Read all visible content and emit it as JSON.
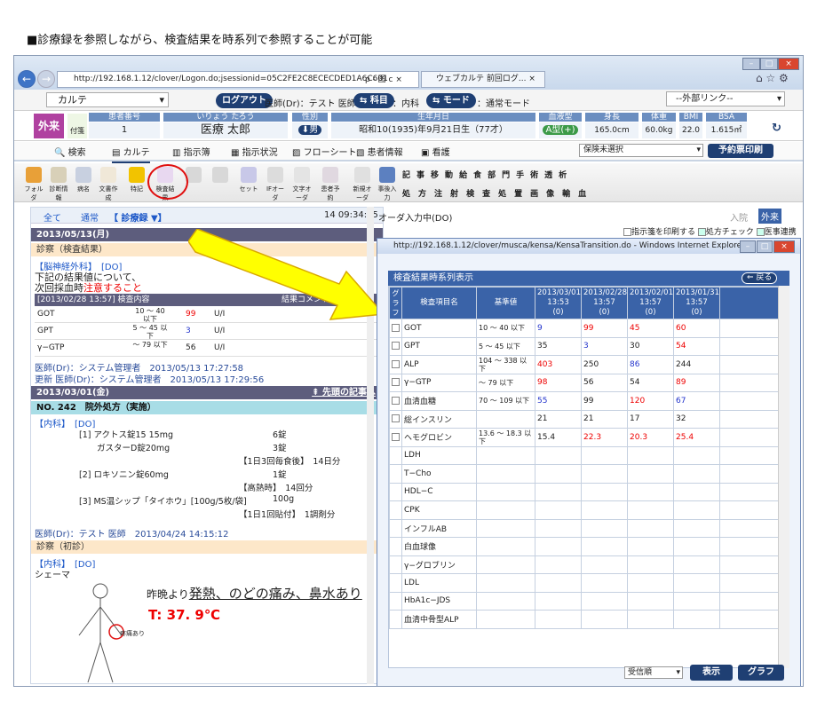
{
  "caption": "■診療録を参照しながら、検査結果を時系列で参照することが可能",
  "browser": {
    "url": "http://192.168.1.12/clover/Logon.do;jsessionid=05C2FE2C8ECECDED1A6C601",
    "tab_title": "ウェブカルテ 前回ログ...",
    "search_glyph": "ρ - 图 c ×"
  },
  "app": {
    "module": "カルテ",
    "logout": "ログアウト",
    "user": "医師(Dr)：テスト 医師",
    "dept_btn": "科目",
    "dept": "内科",
    "mode_btn": "モード",
    "mode": "通常モード",
    "external": "--外部リンク--"
  },
  "patient": {
    "type": "外来",
    "clerk": "付箋",
    "headers": [
      "患者番号",
      "いりょう たろう",
      "性別",
      "生年月日",
      "血液型",
      "身長",
      "体重",
      "BMI",
      "BSA"
    ],
    "id": "1",
    "name": "医療 太郎",
    "sex": "男",
    "birth": "昭和10(1935)年9月21日生（77才）",
    "blood": "A型(+)",
    "height": "165.0cm",
    "weight": "60.0kg",
    "bmi": "22.0",
    "bsa": "1.615㎡"
  },
  "menu": [
    "検索",
    "カルテ",
    "指示簿",
    "指示状況",
    "フローシート",
    "患者情報",
    "看護"
  ],
  "insurance": "保険未選択",
  "print_btn": "予約票印刷",
  "toolbar": [
    "フォルダ",
    "診断情報",
    "病名",
    "文書作成",
    "特記",
    "検査結果",
    "",
    "",
    "セット",
    "IFオーダ",
    "文字オーダ",
    "患者予約",
    "新規オーダ",
    "事後入力"
  ],
  "order_groups": {
    "row1": [
      "記",
      "事",
      "移",
      "動",
      "給",
      "食",
      "部",
      "門",
      "手",
      "術",
      "透",
      "析"
    ],
    "row2": [
      "処",
      "方",
      "注",
      "射",
      "検",
      "査",
      "処",
      "置",
      "画",
      "像",
      "輸",
      "血"
    ]
  },
  "left": {
    "filter_all": "全て",
    "filter_normal": "通常",
    "filter_record": "【 診療録 ▼】",
    "time": "14 09:34:55",
    "d1": "2013/05/13(月)",
    "s1": "診察（検査結果）",
    "dept1": "【脳神経外科】　[DO]",
    "note1": "下記の結果値について、",
    "note2a": "次回採血時",
    "note2b": "注意すること",
    "labhead": "[2013/02/28 13:57] 検査内容",
    "labcomment": "結果コメント",
    "labs": [
      {
        "n": "GOT",
        "r": "10 ～ 40 以下",
        "v": "99",
        "u": "U/I",
        "c": "red"
      },
      {
        "n": "GPT",
        "r": "5 ～ 45 以下",
        "v": "3",
        "u": "U/I",
        "c": "blu"
      },
      {
        "n": "γ−GTP",
        "r": "～ 79 以下",
        "v": "56",
        "u": "U/I",
        "c": ""
      }
    ],
    "doc1": "医師(Dr)：システム管理者　2013/05/13 17:27:58",
    "upd1": "更新 医師(Dr)：システム管理者　2013/05/13 17:29:56",
    "d2": "2013/03/01(金)",
    "d2link": "先頭の記事へ",
    "rx": "NO. 242　院外処方（実施）",
    "dept2": "【内科】　[DO]",
    "rxlines": [
      [
        "[1] アクトス錠15  15mg",
        "6錠"
      ],
      [
        "ガスターD錠20mg",
        "3錠"
      ],
      [
        "【1日3回毎食後】　14日分",
        ""
      ],
      [
        "[2] ロキソニン錠60mg",
        "1錠"
      ],
      [
        "【高熱時】　14回分",
        ""
      ],
      [
        "[3] MS温シップ「タイホウ」[100g/5枚/袋]",
        "100g"
      ],
      [
        "【1日1回貼付】　1調剤分",
        ""
      ]
    ],
    "doc2": "医師(Dr)：テスト 医師　2013/04/24 14:15:12",
    "s3": "診察（初診）",
    "dept3": "【内科】　[DO]",
    "schema": "シェーマ",
    "handwrite1a": "昨晩より",
    "handwrite1b": "発熱、のどの痛み、鼻水あり",
    "temp": "T: 37. 9℃",
    "pain": "疼痛あり"
  },
  "right": {
    "header": "オーダ入力中(DO)",
    "in": "入院",
    "out": "外来",
    "chk1": "指示箋を印刷する",
    "chk2": "処方チェック",
    "chk3": "医事連携"
  },
  "popup": {
    "title": "http://192.168.1.12/clover/musca/kensa/KensaTransition.do - Windows Internet Explorer",
    "section": "検査結果時系列表示",
    "back": "戻る",
    "cols": [
      "グラフ",
      "検査項目名",
      "基準値"
    ],
    "dates": [
      [
        "2013/03/01",
        "13:53",
        "(0)"
      ],
      [
        "2013/02/28",
        "13:57",
        "(0)"
      ],
      [
        "2013/02/01",
        "13:57",
        "(0)"
      ],
      [
        "2013/01/31",
        "13:57",
        "(0)"
      ]
    ],
    "rows": [
      {
        "n": "GOT",
        "r": "10 ～ 40 以下",
        "v": [
          [
            "9",
            "blu"
          ],
          [
            "99",
            "red"
          ],
          [
            "45",
            "red"
          ],
          [
            "60",
            "red"
          ]
        ],
        "cb": true
      },
      {
        "n": "GPT",
        "r": "5 ～ 45 以下",
        "v": [
          [
            "35",
            ""
          ],
          [
            "3",
            "blu"
          ],
          [
            "30",
            ""
          ],
          [
            "54",
            "red"
          ]
        ],
        "cb": true
      },
      {
        "n": "ALP",
        "r": "104 ～ 338 以下",
        "v": [
          [
            "403",
            "red"
          ],
          [
            "250",
            ""
          ],
          [
            "86",
            "blu"
          ],
          [
            "244",
            ""
          ]
        ],
        "cb": true
      },
      {
        "n": "γ−GTP",
        "r": "～ 79 以下",
        "v": [
          [
            "98",
            "red"
          ],
          [
            "56",
            ""
          ],
          [
            "54",
            ""
          ],
          [
            "89",
            "red"
          ]
        ],
        "cb": true
      },
      {
        "n": "血清血糖",
        "r": "70 ～ 109 以下",
        "v": [
          [
            "55",
            "blu"
          ],
          [
            "99",
            ""
          ],
          [
            "120",
            "red"
          ],
          [
            "67",
            "blu"
          ]
        ],
        "cb": true
      },
      {
        "n": "総インスリン",
        "r": "",
        "v": [
          [
            "21",
            ""
          ],
          [
            "21",
            ""
          ],
          [
            "17",
            ""
          ],
          [
            "32",
            ""
          ]
        ],
        "cb": true
      },
      {
        "n": "ヘモグロビン",
        "r": "13.6 ～ 18.3 以下",
        "v": [
          [
            "15.4",
            ""
          ],
          [
            "22.3",
            "red"
          ],
          [
            "20.3",
            "red"
          ],
          [
            "25.4",
            "red"
          ]
        ],
        "cb": true
      },
      {
        "n": "LDH",
        "r": "",
        "v": [],
        "cb": false
      },
      {
        "n": "T−Cho",
        "r": "",
        "v": [],
        "cb": false
      },
      {
        "n": "HDL−C",
        "r": "",
        "v": [],
        "cb": false
      },
      {
        "n": "CPK",
        "r": "",
        "v": [],
        "cb": false
      },
      {
        "n": "インフルAB",
        "r": "",
        "v": [],
        "cb": false
      },
      {
        "n": "白血球像",
        "r": "",
        "v": [],
        "cb": false
      },
      {
        "n": "γ−グロブリン",
        "r": "",
        "v": [],
        "cb": false
      },
      {
        "n": "LDL",
        "r": "",
        "v": [],
        "cb": false
      },
      {
        "n": "HbA1c−JDS",
        "r": "",
        "v": [],
        "cb": false
      },
      {
        "n": "血清中骨型ALP",
        "r": "",
        "v": [],
        "cb": false
      }
    ],
    "sort": "受信順",
    "show": "表示",
    "graph": "グラフ"
  },
  "colors": {
    "navy": "#1f3f73",
    "table_header": "#3a63a8",
    "highlight": "#ffff00",
    "circle": "#e01010"
  }
}
